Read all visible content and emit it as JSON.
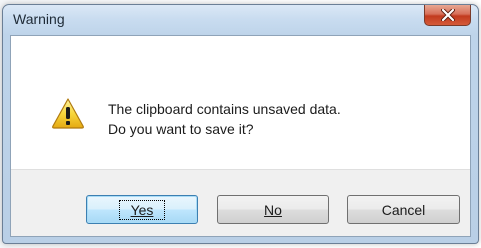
{
  "window": {
    "title": "Warning"
  },
  "message": {
    "line1": "The clipboard contains unsaved data.",
    "line2": "Do you want to save it?"
  },
  "buttons": {
    "yes_label": "Yes",
    "no_label": "No",
    "cancel_label": "Cancel"
  },
  "icons": {
    "warning": "warning-icon",
    "close": "close-icon"
  },
  "colors": {
    "close_button": "#c23b1f",
    "warning_yellow": "#f7d63d",
    "default_button_border": "#3c7fb1"
  }
}
